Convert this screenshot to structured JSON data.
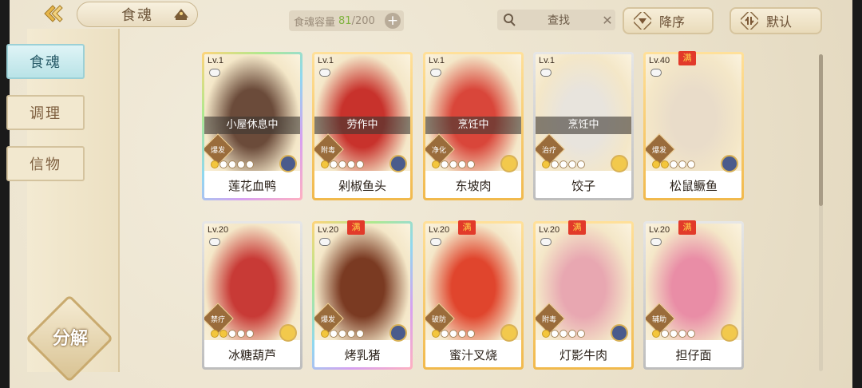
{
  "header": {
    "title": "食魂",
    "capacity_label": "食魂容量",
    "capacity_current": "81",
    "capacity_max": "/200",
    "search_placeholder": "查找",
    "sort_label": "降序",
    "default_label": "默认"
  },
  "sidebar": {
    "items": [
      {
        "label": "食魂",
        "active": true
      },
      {
        "label": "调理",
        "active": false
      },
      {
        "label": "信物",
        "active": false
      }
    ],
    "decompose_label": "分解"
  },
  "cards": [
    {
      "level": "Lv.1",
      "status": "小屋休息中",
      "tag": "爆发",
      "name": "莲花血鸭",
      "full": false,
      "frame": "rainbow",
      "stars": 1,
      "medal": "blue",
      "art": "#6b4b3a"
    },
    {
      "level": "Lv.1",
      "status": "劳作中",
      "tag": "附毒",
      "name": "剁椒鱼头",
      "full": false,
      "frame": "gold",
      "stars": 1,
      "medal": "blue",
      "art": "#c8322c"
    },
    {
      "level": "Lv.1",
      "status": "烹饪中",
      "tag": "净化",
      "name": "东坡肉",
      "full": false,
      "frame": "gold",
      "stars": 1,
      "medal": "gold",
      "art": "#d9463a"
    },
    {
      "level": "Lv.1",
      "status": "烹饪中",
      "tag": "治疗",
      "name": "饺子",
      "full": false,
      "frame": "silver",
      "stars": 1,
      "medal": "gold",
      "art": "#e8e4dd"
    },
    {
      "level": "Lv.40",
      "status": "",
      "tag": "爆发",
      "name": "松鼠鳜鱼",
      "full": true,
      "frame": "gold",
      "stars": 2,
      "medal": "blue",
      "art": "#e9dcc9"
    },
    {
      "level": "Lv.20",
      "status": "",
      "tag": "禁疗",
      "name": "冰糖葫芦",
      "full": false,
      "frame": "silver",
      "stars": 2,
      "medal": "gold",
      "art": "#c83a36"
    },
    {
      "level": "Lv.20",
      "status": "",
      "tag": "爆发",
      "name": "烤乳猪",
      "full": true,
      "frame": "rainbow",
      "stars": 1,
      "medal": "blue",
      "art": "#7a3a22"
    },
    {
      "level": "Lv.20",
      "status": "",
      "tag": "破防",
      "name": "蜜汁叉烧",
      "full": true,
      "frame": "gold",
      "stars": 1,
      "medal": "gold",
      "art": "#e0452d"
    },
    {
      "level": "Lv.20",
      "status": "",
      "tag": "附毒",
      "name": "灯影牛肉",
      "full": true,
      "frame": "gold",
      "stars": 1,
      "medal": "blue",
      "art": "#e8a7b1"
    },
    {
      "level": "Lv.20",
      "status": "",
      "tag": "辅助",
      "name": "担仔面",
      "full": true,
      "frame": "silver",
      "stars": 1,
      "medal": "gold",
      "art": "#e98da6"
    }
  ],
  "colors": {
    "accent": "#7fb33f",
    "active_tab": "#b9e3e7",
    "full_badge": "#e23a2a"
  }
}
